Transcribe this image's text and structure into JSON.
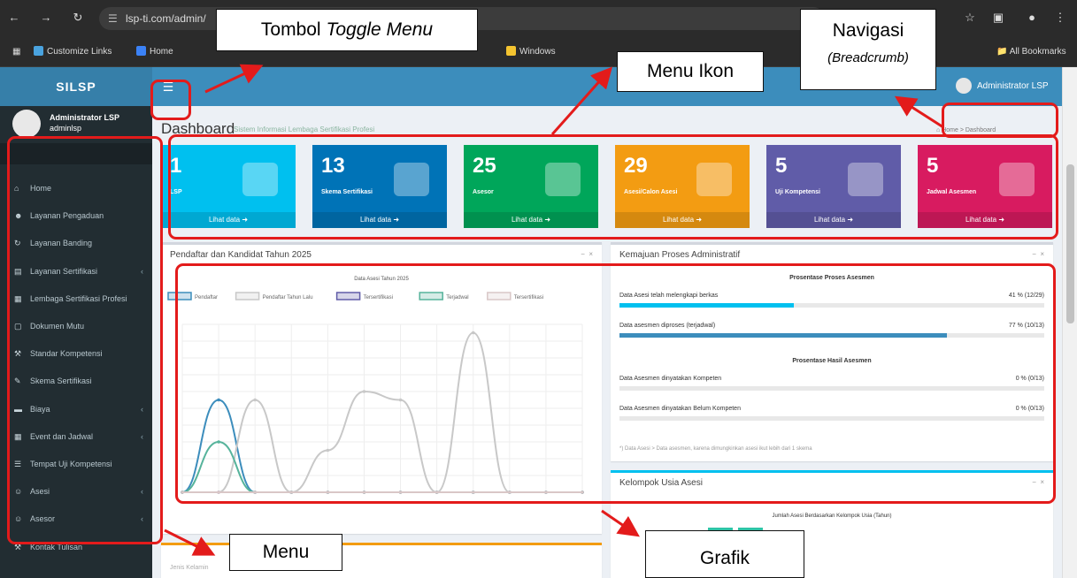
{
  "browser": {
    "url": "lsp-ti.com/admin/",
    "bookmarks": [
      "Customize Links",
      "Home",
      "Windows"
    ],
    "all_bookmarks": "All Bookmarks"
  },
  "header": {
    "logo": "SILSP",
    "toggle_icon": "hamburger-icon",
    "user_name": "Administrator LSP"
  },
  "sidebar": {
    "user_name": "Administrator LSP",
    "user_login": "adminlsp",
    "items": [
      {
        "label": "Home",
        "icon": "home-icon",
        "arrow": false
      },
      {
        "label": "Layanan Pengaduan",
        "icon": "users-icon",
        "arrow": false
      },
      {
        "label": "Layanan Banding",
        "icon": "refresh-icon",
        "arrow": false
      },
      {
        "label": "Layanan Sertifikasi",
        "icon": "book-icon",
        "arrow": true
      },
      {
        "label": "Lembaga Sertifikasi Profesi",
        "icon": "building-icon",
        "arrow": false
      },
      {
        "label": "Dokumen Mutu",
        "icon": "file-icon",
        "arrow": false
      },
      {
        "label": "Standar Kompetensi",
        "icon": "wrench-icon",
        "arrow": false
      },
      {
        "label": "Skema Sertifikasi",
        "icon": "edit-icon",
        "arrow": false
      },
      {
        "label": "Biaya",
        "icon": "money-icon",
        "arrow": true
      },
      {
        "label": "Event dan Jadwal",
        "icon": "calendar-icon",
        "arrow": true
      },
      {
        "label": "Tempat Uji Kompetensi",
        "icon": "list-icon",
        "arrow": false
      },
      {
        "label": "Asesi",
        "icon": "user-icon",
        "arrow": true
      },
      {
        "label": "Asesor",
        "icon": "user-icon",
        "arrow": true
      },
      {
        "label": "Kontak Tulisan",
        "icon": "wrench-icon",
        "arrow": false
      }
    ]
  },
  "page": {
    "title": "Dashboard",
    "subtitle": "Sistem Informasi Lembaga Sertifikasi Profesi",
    "breadcrumb": [
      "Home",
      "Dashboard"
    ]
  },
  "cards": [
    {
      "value": "1",
      "label": "LSP",
      "link": "Lihat data",
      "color": "#00c0ef"
    },
    {
      "value": "13",
      "label": "Skema Sertifikasi",
      "link": "Lihat data",
      "color": "#0073b7"
    },
    {
      "value": "25",
      "label": "Asesor",
      "link": "Lihat data",
      "color": "#00a65a"
    },
    {
      "value": "29",
      "label": "Asesi/Calon Asesi",
      "link": "Lihat data",
      "color": "#f39c12"
    },
    {
      "value": "5",
      "label": "Uji Kompetensi",
      "link": "Lihat data",
      "color": "#605ca8"
    },
    {
      "value": "5",
      "label": "Jadwal Asesmen",
      "link": "Lihat data",
      "color": "#d81b60"
    }
  ],
  "chart_box": {
    "title": "Pendaftar dan Kandidat Tahun 2025"
  },
  "chart_data": {
    "type": "line",
    "title": "Data Asesi Tahun 2025",
    "legend_position": "top",
    "grid": true,
    "ylim": [
      0,
      20
    ],
    "series": [
      {
        "name": "Pendaftar",
        "color": "#3c8dbc",
        "values": [
          0,
          11,
          0,
          0,
          0,
          0,
          0,
          0,
          0,
          0,
          0,
          0
        ]
      },
      {
        "name": "Pendaftar Tahun Lalu",
        "color": "#c8c8c8",
        "values": [
          0,
          0,
          11,
          0,
          5,
          12,
          11,
          0,
          19,
          0,
          0,
          0
        ]
      },
      {
        "name": "Tersertifikasi",
        "color": "#605ca8",
        "values": [
          0,
          0,
          0,
          0,
          0,
          0,
          0,
          0,
          0,
          0,
          0,
          0
        ]
      },
      {
        "name": "Terjadwal",
        "color": "#56b39b",
        "values": [
          0,
          6,
          0,
          0,
          0,
          0,
          0,
          0,
          0,
          0,
          0,
          0
        ]
      },
      {
        "name": "Tersertifikasi",
        "color": "#d9c7c7",
        "values": [
          0,
          0,
          0,
          0,
          0,
          0,
          0,
          0,
          0,
          0,
          0,
          0
        ]
      }
    ]
  },
  "progress_box": {
    "title": "Kemajuan Proses Administratif",
    "head1": "Prosentase Proses Asesmen",
    "head2": "Prosentase Hasil Asesmen",
    "items": [
      {
        "label": "Data Asesi telah melengkapi berkas",
        "value": "41 % (12/29)",
        "fill": 0.41,
        "color": "#00c0ef"
      },
      {
        "label": "Data asesmen diproses (terjadwal)",
        "value": "77 % (10/13)",
        "fill": 0.77,
        "color": "#3c8dbc"
      },
      {
        "label": "Data Asesmen dinyatakan Kompeten",
        "value": "0 % (0/13)",
        "fill": 0,
        "color": "#00a65a"
      },
      {
        "label": "Data Asesmen dinyatakan Belum Kompeten",
        "value": "0 % (0/13)",
        "fill": 0,
        "color": "#dd4b39"
      }
    ],
    "note": "*) Data Asesi > Data asesmen, karena dimungkinkan asesi ikut lebih dari 1 skema"
  },
  "age_box": {
    "title": "Kelompok Usia Asesi",
    "chart_title": "Jumlah Asesi Berdasarkan Kelompok Usia (Tahun)"
  },
  "bottom_box": {
    "title": "Jenis Kelamin"
  },
  "annotations": {
    "toggle": {
      "prefix": "Tombol ",
      "italic": "Toggle Menu"
    },
    "breadcrumb_title": "Navigasi",
    "breadcrumb_sub": "(Breadcrumb)",
    "menu_icon": "Menu Ikon",
    "menu": "Menu",
    "chart": "Grafik"
  }
}
